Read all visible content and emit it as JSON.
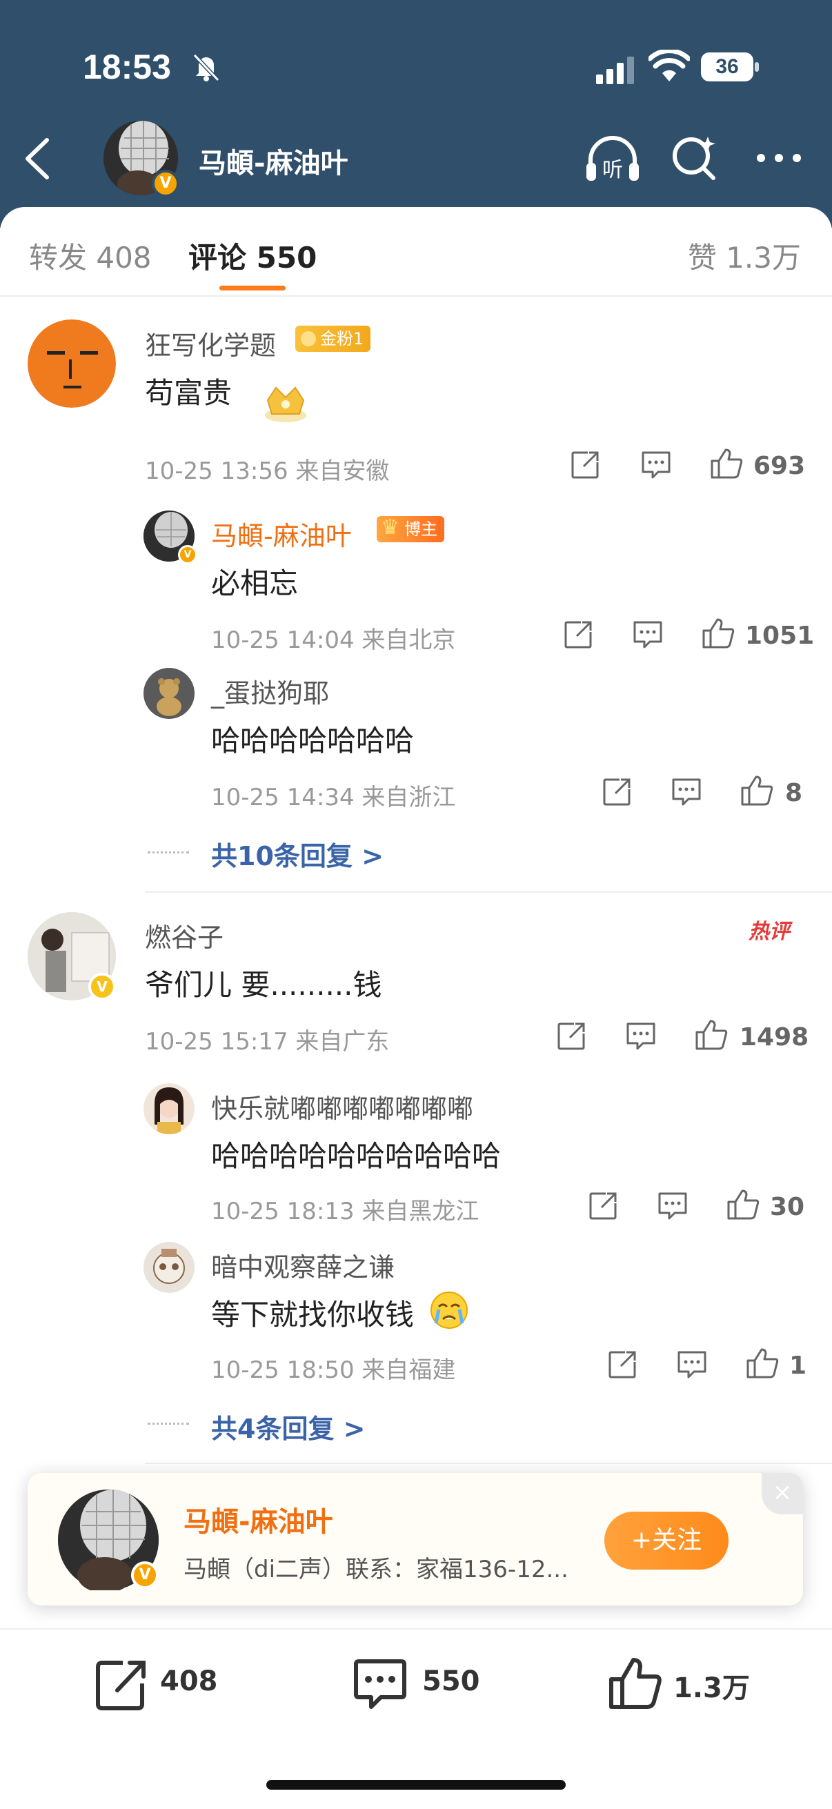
{
  "status_bar": {
    "time": "18:53",
    "battery": "36"
  },
  "nav": {
    "title": "马頔-麻油叶"
  },
  "tabs": [
    {
      "label": "转发 408"
    },
    {
      "label": "评论 550",
      "active": true
    },
    {
      "label": "赞 1.3万"
    }
  ],
  "comments": [
    {
      "user": "狂写化学题",
      "badge": "金粉1",
      "text": "苟富贵",
      "meta": "10-25 13:56 来自安徽",
      "likes": "693",
      "replies": [
        {
          "user": "马頔-麻油叶",
          "badge": "博主",
          "text": "必相忘",
          "meta": "10-25 14:04 来自北京",
          "likes": "1051"
        },
        {
          "user": "_蛋挞狗耶",
          "text": "哈哈哈哈哈哈哈",
          "meta": "10-25 14:34 来自浙江",
          "likes": "8"
        }
      ],
      "more_replies": "共10条回复 >"
    },
    {
      "user": "燃谷子",
      "hot_tag": "热评",
      "text": "爷们儿 要.........钱",
      "meta": "10-25 15:17 来自广东",
      "likes": "1498",
      "replies": [
        {
          "user": "快乐就嘟嘟嘟嘟嘟嘟嘟",
          "text": "哈哈哈哈哈哈哈哈哈哈",
          "meta": "10-25 18:13 来自黑龙江",
          "likes": "30"
        },
        {
          "user": "暗中观察薛之谦",
          "text": "等下就找你收钱",
          "meta": "10-25 18:50 来自福建",
          "likes": "1"
        }
      ],
      "more_replies": "共4条回复 >"
    }
  ],
  "follow_card": {
    "name": "马頔-麻油叶",
    "desc": "马頔（di二声）联系：家福136-12...",
    "follow_label": "+关注"
  },
  "bottom_bar": {
    "repost": "408",
    "comment": "550",
    "like": "1.3万"
  },
  "colors": {
    "header": "#2f4f6a",
    "accent": "#ff7a1a",
    "link": "#3b64a8",
    "author": "#f06f12"
  }
}
